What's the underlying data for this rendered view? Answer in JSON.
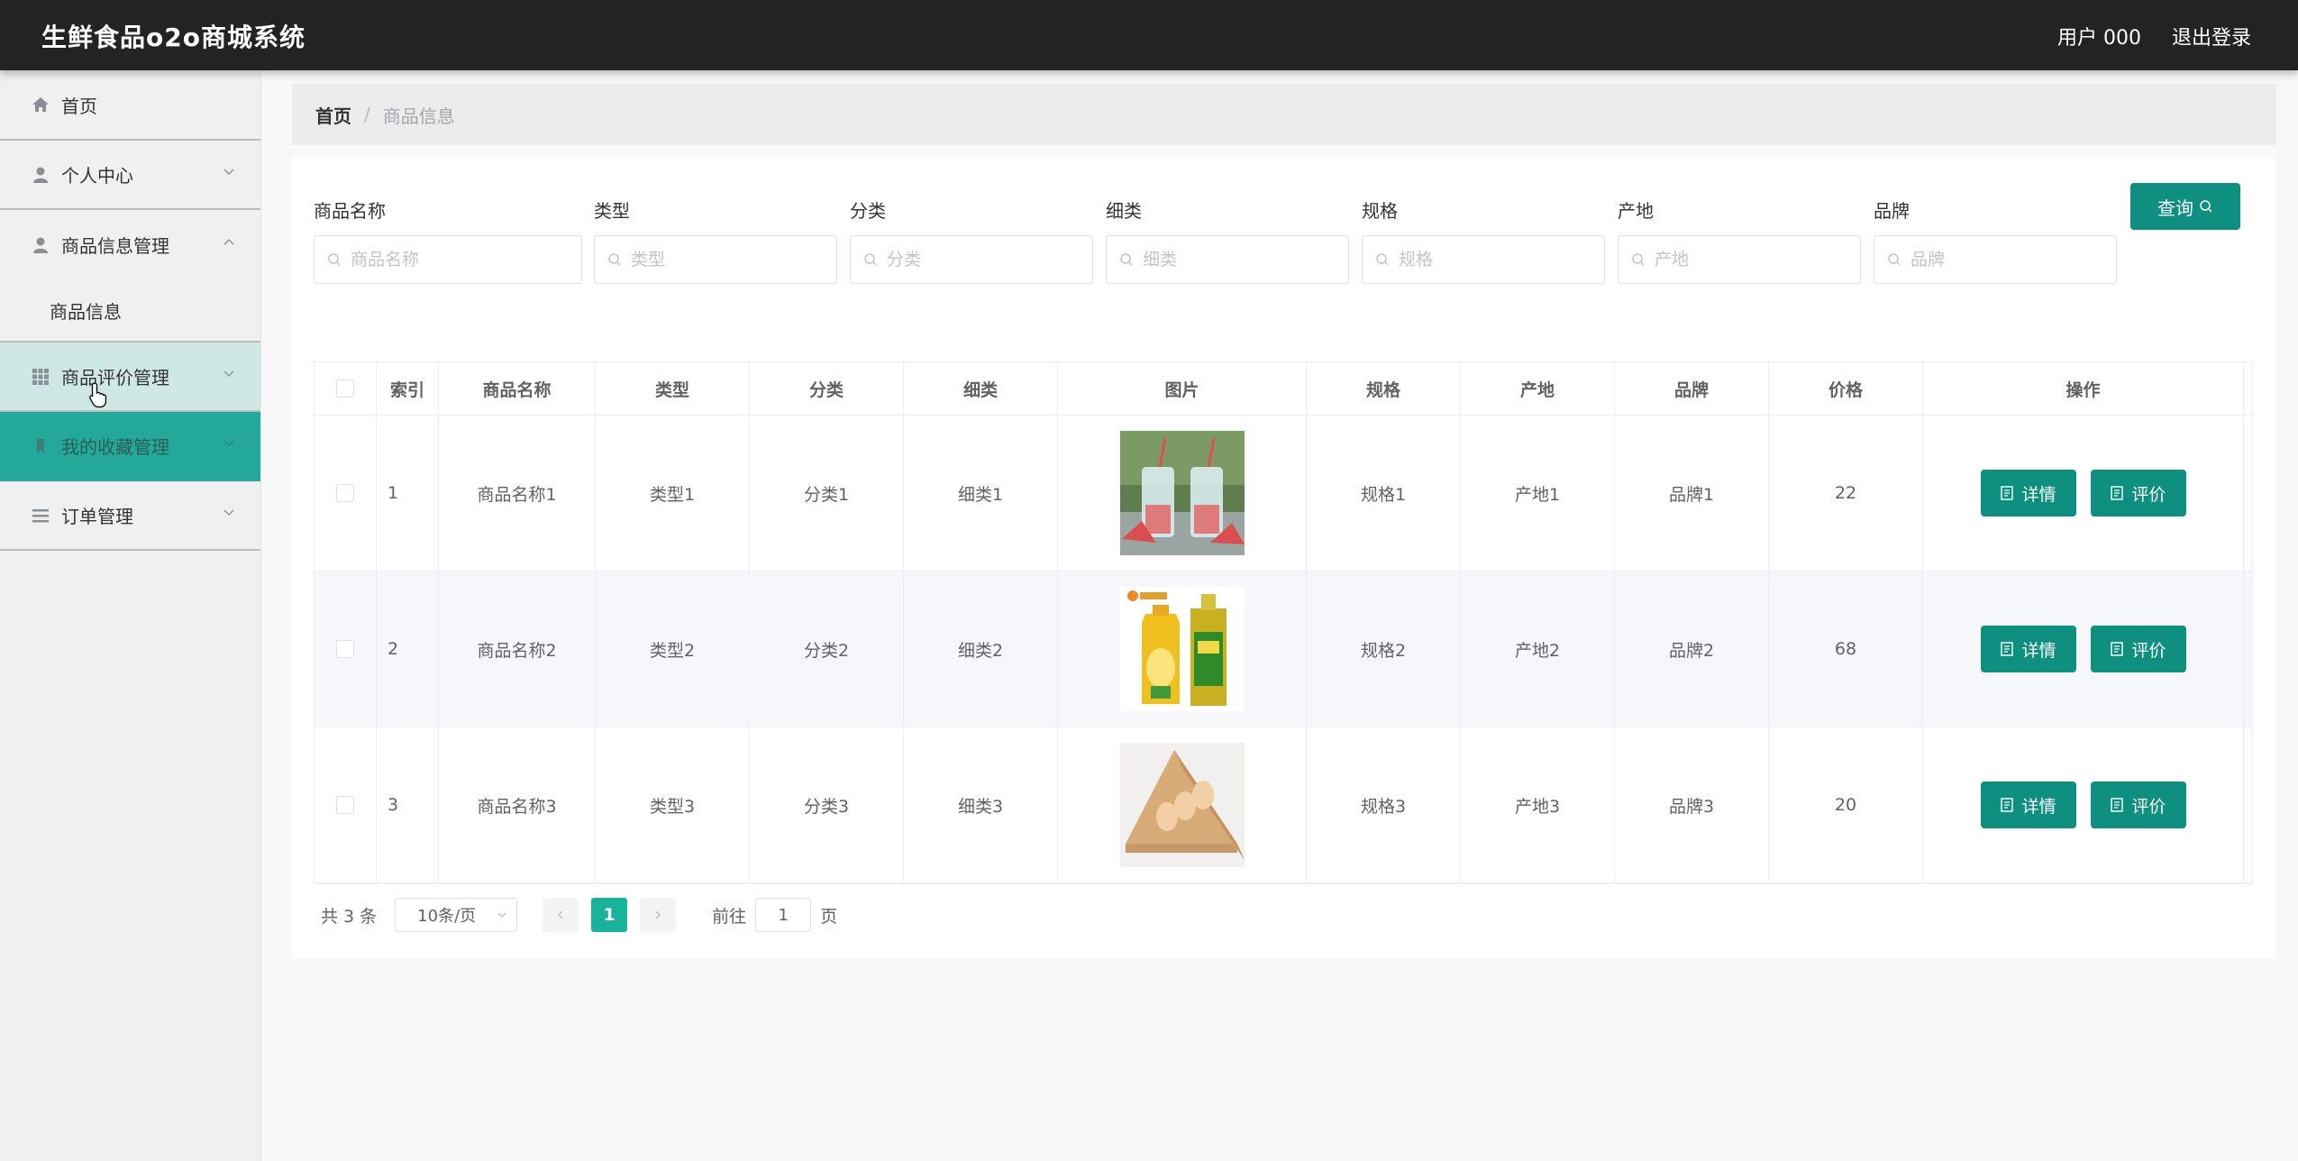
{
  "header": {
    "title": "生鲜食品o2o商城系统",
    "user": "用户 000",
    "logout": "退出登录"
  },
  "sidebar": {
    "items": [
      {
        "label": "首页",
        "icon": "home-icon"
      },
      {
        "label": "个人中心",
        "icon": "user-icon"
      },
      {
        "label": "商品信息管理",
        "icon": "user-icon",
        "sub": "商品信息"
      },
      {
        "label": "商品评价管理",
        "icon": "grid-icon"
      },
      {
        "label": "我的收藏管理",
        "icon": "bookmark-icon"
      },
      {
        "label": "订单管理",
        "icon": "list-icon"
      }
    ]
  },
  "breadcrumb": {
    "home": "首页",
    "sep": "/",
    "current": "商品信息"
  },
  "filters": [
    {
      "label": "商品名称",
      "placeholder": "商品名称"
    },
    {
      "label": "类型",
      "placeholder": "类型"
    },
    {
      "label": "分类",
      "placeholder": "分类"
    },
    {
      "label": "细类",
      "placeholder": "细类"
    },
    {
      "label": "规格",
      "placeholder": "规格"
    },
    {
      "label": "产地",
      "placeholder": "产地"
    },
    {
      "label": "品牌",
      "placeholder": "品牌"
    }
  ],
  "query_button": "查询",
  "table": {
    "headers": [
      "索引",
      "商品名称",
      "类型",
      "分类",
      "细类",
      "图片",
      "规格",
      "产地",
      "品牌",
      "价格",
      "操作"
    ],
    "rows": [
      {
        "index": "1",
        "name": "商品名称1",
        "type": "类型1",
        "category": "分类1",
        "subcategory": "细类1",
        "spec": "规格1",
        "origin": "产地1",
        "brand": "品牌1",
        "price": "22"
      },
      {
        "index": "2",
        "name": "商品名称2",
        "type": "类型2",
        "category": "分类2",
        "subcategory": "细类2",
        "spec": "规格2",
        "origin": "产地2",
        "brand": "品牌2",
        "price": "68"
      },
      {
        "index": "3",
        "name": "商品名称3",
        "type": "类型3",
        "category": "分类3",
        "subcategory": "细类3",
        "spec": "规格3",
        "origin": "产地3",
        "brand": "品牌3",
        "price": "20"
      }
    ],
    "detail_label": "详情",
    "review_label": "评价"
  },
  "pagination": {
    "total": "共 3 条",
    "page_size": "10条/页",
    "current": "1",
    "goto": "前往",
    "goto_value": "1",
    "page_unit": "页"
  },
  "colors": {
    "primary": "#0e8f80",
    "active_menu": "#24a899",
    "hover_menu": "#cfe8e5",
    "topbar": "#232323"
  }
}
